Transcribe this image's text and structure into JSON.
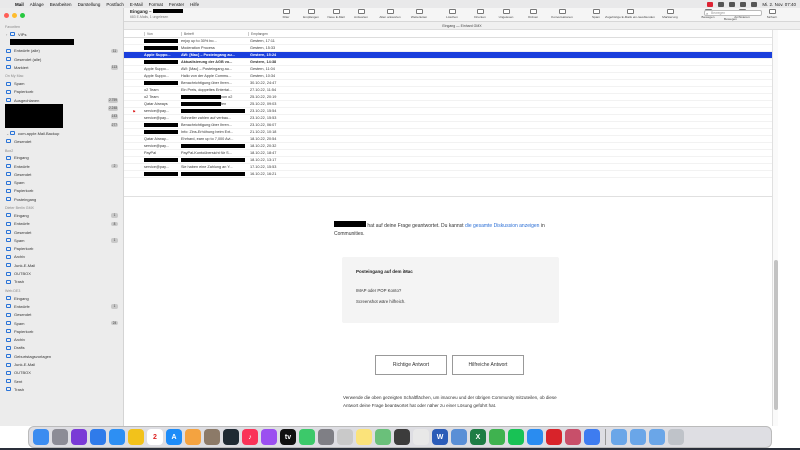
{
  "menubar": {
    "apple": "",
    "items": [
      "Mail",
      "Ablage",
      "Bearbeiten",
      "Darstellung",
      "Postfach",
      "E-Mail",
      "Format",
      "Fenster",
      "Hilfe"
    ],
    "clock": "Mi. 2. Nov. 07:40"
  },
  "sidebar": {
    "favorites_header": "Favoriten",
    "vips": "VIPs",
    "fav_items": [
      {
        "label": "Entwürfe (alle)",
        "count": "11"
      },
      {
        "label": "Gesendet (alle)",
        "count": ""
      },
      {
        "label": "Markiert",
        "count": "113"
      }
    ],
    "mac_header": "On My Mac",
    "mac_items": [
      {
        "label": "Spam",
        "count": ""
      },
      {
        "label": "Papierkorb",
        "count": ""
      },
      {
        "label": "Ausgechlanen",
        "count": "2.759"
      }
    ],
    "counts_extra": [
      "2.248",
      "143",
      "277"
    ],
    "backup_header": "com.apple.Mail.Backup",
    "backup_items": [
      {
        "label": "Gesendet"
      }
    ],
    "acct2_header": "Box2",
    "acct2_items": [
      {
        "label": "Eingang",
        "count": ""
      },
      {
        "label": "Entwürfe",
        "count": "2"
      },
      {
        "label": "Gesendet",
        "count": ""
      },
      {
        "label": "Spam",
        "count": ""
      },
      {
        "label": "Papierkorb",
        "count": ""
      },
      {
        "label": "Posteingang",
        "count": ""
      }
    ],
    "acct3_header": "Dieter Berlin GMX",
    "acct3_items": [
      {
        "label": "Eingang",
        "count": "1"
      },
      {
        "label": "Entwürfe",
        "count": "8"
      },
      {
        "label": "Gesendet",
        "count": ""
      },
      {
        "label": "Spam",
        "count": "1"
      },
      {
        "label": "Papierkorb",
        "count": ""
      },
      {
        "label": "Archiv",
        "count": ""
      },
      {
        "label": "Junk-E-Mail",
        "count": ""
      },
      {
        "label": "OUTBOX",
        "count": ""
      },
      {
        "label": "Trash",
        "count": ""
      }
    ],
    "acct4_header": "Web.DE3",
    "acct4_items": [
      {
        "label": "Eingang",
        "count": ""
      },
      {
        "label": "Entwürfe",
        "count": "1"
      },
      {
        "label": "Gesendet",
        "count": ""
      },
      {
        "label": "Spam",
        "count": "24"
      },
      {
        "label": "Papierkorb",
        "count": ""
      },
      {
        "label": "Archiv",
        "count": ""
      },
      {
        "label": "Drafts",
        "count": ""
      },
      {
        "label": "Geburtstagsvorlagen",
        "count": ""
      },
      {
        "label": "Junk-E-Mail",
        "count": ""
      },
      {
        "label": "OUTBOX",
        "count": ""
      },
      {
        "label": "Sent",
        "count": ""
      },
      {
        "label": "Trash",
        "count": ""
      }
    ]
  },
  "toolbar": {
    "title": "Eingang –",
    "subtitle": "683 E-Mails, 1 ungelesen",
    "buttons": [
      "Filter",
      "Empfangen",
      "Neue E-Mail",
      "Antworten",
      "Allen antworten",
      "Weiterleiten",
      "Löschen",
      "Drucken",
      "Ungelesen",
      "Ordnen",
      "Konversationen",
      "Spam",
      "Zugehörige E-Mails ein-/ausblenden",
      "Markierung",
      "Bewegen",
      "Archivieren",
      "Sichern"
    ],
    "search_placeholder": "Bewegen",
    "search_label": "Bewegen",
    "subbar": "Eingang — Einhard GMX"
  },
  "list": {
    "headers": {
      "from": "Von",
      "subject": "Betreff",
      "date": "Empfangen"
    },
    "rows": [
      {
        "from": "",
        "subject": "enjoy up to 30% bo...",
        "date": "Gestern, 17:11",
        "style": "normal",
        "flag": ""
      },
      {
        "from": "",
        "subject": "Moderation Process",
        "date": "Gestern, 15:33",
        "style": "normal",
        "flag": ""
      },
      {
        "from": "Apple Suppo...",
        "subject": "AW: [Mac] – Posteingang au...",
        "date": "Gestern, 15:24",
        "style": "selected",
        "flag": ""
      },
      {
        "from": "",
        "subject": "Aktualisierung der AGB vo...",
        "date": "Gestern, 14:38",
        "style": "bold",
        "flag": ""
      },
      {
        "from": "Apple Suppo...",
        "subject": "AW: [Mac] – Posteingang au...",
        "date": "Gestern, 11:04",
        "style": "normal",
        "flag": ""
      },
      {
        "from": "Apple Suppo...",
        "subject": "Hallo von der Apple Commu...",
        "date": "Gestern, 10:34",
        "style": "normal",
        "flag": ""
      },
      {
        "from": "",
        "subject": "Benachrichtigung über Ihren...",
        "date": "30.10.22, 24:47",
        "style": "normal",
        "flag": ""
      },
      {
        "from": "o2 Team",
        "subject": "Ein Preis, doppeltes Entertai...",
        "date": "27.10.22, 11:54",
        "style": "normal",
        "flag": ""
      },
      {
        "from": "o2 Team",
        "subject": "von o2",
        "date": "25.10.22, 20:19",
        "style": "normal",
        "flag": ""
      },
      {
        "from": "Qatar Airways",
        "subject": "fen",
        "date": "25.10.22, 09:03",
        "style": "normal",
        "flag": ""
      },
      {
        "from": "service@pay...",
        "subject": "",
        "date": "23.10.22, 15:54",
        "style": "normal",
        "flag": "⚑"
      },
      {
        "from": "service@pay...",
        "subject": "Schneller zahlen auf verbau...",
        "date": "23.10.22, 15:53",
        "style": "normal",
        "flag": ""
      },
      {
        "from": "",
        "subject": "Benachrichtigung über Ihren...",
        "date": "23.10.22, 06:07",
        "style": "normal",
        "flag": ""
      },
      {
        "from": "",
        "subject": "Info: Zins-Erhöhung beim Ext...",
        "date": "21.10.22, 10:18",
        "style": "normal",
        "flag": ""
      },
      {
        "from": "Qatar Airway...",
        "subject": "Ehrhard, earn up to 7,000 Avi...",
        "date": "18.10.22, 20:54",
        "style": "normal",
        "flag": ""
      },
      {
        "from": "service@pay...",
        "subject": "",
        "date": "18.10.22, 20:32",
        "style": "normal",
        "flag": ""
      },
      {
        "from": "PayPal",
        "subject": "PayPal-Kontoübersicht für S...",
        "date": "18.10.22, 18:47",
        "style": "normal",
        "flag": ""
      },
      {
        "from": "",
        "subject": "",
        "date": "18.10.22, 13:17",
        "style": "normal",
        "flag": ""
      },
      {
        "from": "service@pay...",
        "subject": "Sie haben eine Zahlung an Y...",
        "date": "17.10.22, 15:53",
        "style": "normal",
        "flag": ""
      },
      {
        "from": "",
        "subject": "",
        "date": "16.10.22, 16:21",
        "style": "normal",
        "flag": ""
      }
    ]
  },
  "content": {
    "answered_text": "hat auf deine Frage geantwortet. Du kannst",
    "answered_link": "die gesamte Diskussion anzeigen",
    "answered_tail": "in Communities.",
    "quote_title": "Posteingang auf dem iMac",
    "quote_line1": "IMAP oder POP Konto?",
    "quote_line2": "Screenshot wäre hilfreich.",
    "btn_correct": "Richtige Antwort",
    "btn_helpful": "Hilfreiche Antwort",
    "footer": "Verwende die oben gezeigten Schaltflächen, um imacneu und der übrigen Community mitzuteilen, ob diese Antwort deine Frage beantwortet hat oder näher zu einer Lösung geführt hat."
  },
  "dock": {
    "apps": [
      {
        "name": "finder-icon",
        "color": "#3b8cf0",
        "glyph": ""
      },
      {
        "name": "launchpad-icon",
        "color": "#8c8c96",
        "glyph": ""
      },
      {
        "name": "siri-icon",
        "color": "#7a3ad6",
        "glyph": ""
      },
      {
        "name": "mail-icon",
        "color": "#2f7bea",
        "glyph": ""
      },
      {
        "name": "safari-icon",
        "color": "#2d8ff3",
        "glyph": ""
      },
      {
        "name": "chrome-icon",
        "color": "#f2c21b",
        "glyph": ""
      },
      {
        "name": "calendar-icon",
        "color": "#ffffff",
        "glyph": "2"
      },
      {
        "name": "appstore-icon",
        "color": "#1d8cf8",
        "glyph": "A"
      },
      {
        "name": "photos-icon",
        "color": "#f4a340",
        "glyph": ""
      },
      {
        "name": "facetime-icon",
        "color": "#8c7a68",
        "glyph": ""
      },
      {
        "name": "timemachine-icon",
        "color": "#1f2a33",
        "glyph": ""
      },
      {
        "name": "music-icon",
        "color": "#fa3358",
        "glyph": "♪"
      },
      {
        "name": "podcasts-icon",
        "color": "#9b4ff0",
        "glyph": ""
      },
      {
        "name": "appletv-icon",
        "color": "#111111",
        "glyph": "tv"
      },
      {
        "name": "messages-icon",
        "color": "#3cc96a",
        "glyph": ""
      },
      {
        "name": "systemprefs-icon",
        "color": "#7f7f85",
        "glyph": ""
      },
      {
        "name": "scripteditor-icon",
        "color": "#c9c9c9",
        "glyph": ""
      },
      {
        "name": "notes-icon",
        "color": "#fbe37a",
        "glyph": ""
      },
      {
        "name": "maps-icon",
        "color": "#6ac07a",
        "glyph": ""
      },
      {
        "name": "screenshot-icon",
        "color": "#3c3c3c",
        "glyph": ""
      },
      {
        "name": "textedit-icon",
        "color": "#e8e8e8",
        "glyph": ""
      },
      {
        "name": "word-icon",
        "color": "#2b5cb8",
        "glyph": "W"
      },
      {
        "name": "preview-icon",
        "color": "#5a8fd6",
        "glyph": ""
      },
      {
        "name": "excel-icon",
        "color": "#1e7d45",
        "glyph": "X"
      },
      {
        "name": "numbers-icon",
        "color": "#3fb24f",
        "glyph": ""
      },
      {
        "name": "line-icon",
        "color": "#18c255",
        "glyph": ""
      },
      {
        "name": "keynote-icon",
        "color": "#2a8cf0",
        "glyph": ""
      },
      {
        "name": "acrobat-icon",
        "color": "#d8232a",
        "glyph": ""
      },
      {
        "name": "imageviewer-icon",
        "color": "#c84f6a",
        "glyph": ""
      },
      {
        "name": "xcode-icon",
        "color": "#3e7cf0",
        "glyph": ""
      }
    ],
    "folders": [
      {
        "name": "folder-icon",
        "color": "#6aa6e8"
      },
      {
        "name": "downloads-folder-icon",
        "color": "#6aa6e8"
      },
      {
        "name": "documents-folder-icon",
        "color": "#6aa6e8"
      },
      {
        "name": "trash-icon",
        "color": "#bfc3c9"
      }
    ]
  }
}
